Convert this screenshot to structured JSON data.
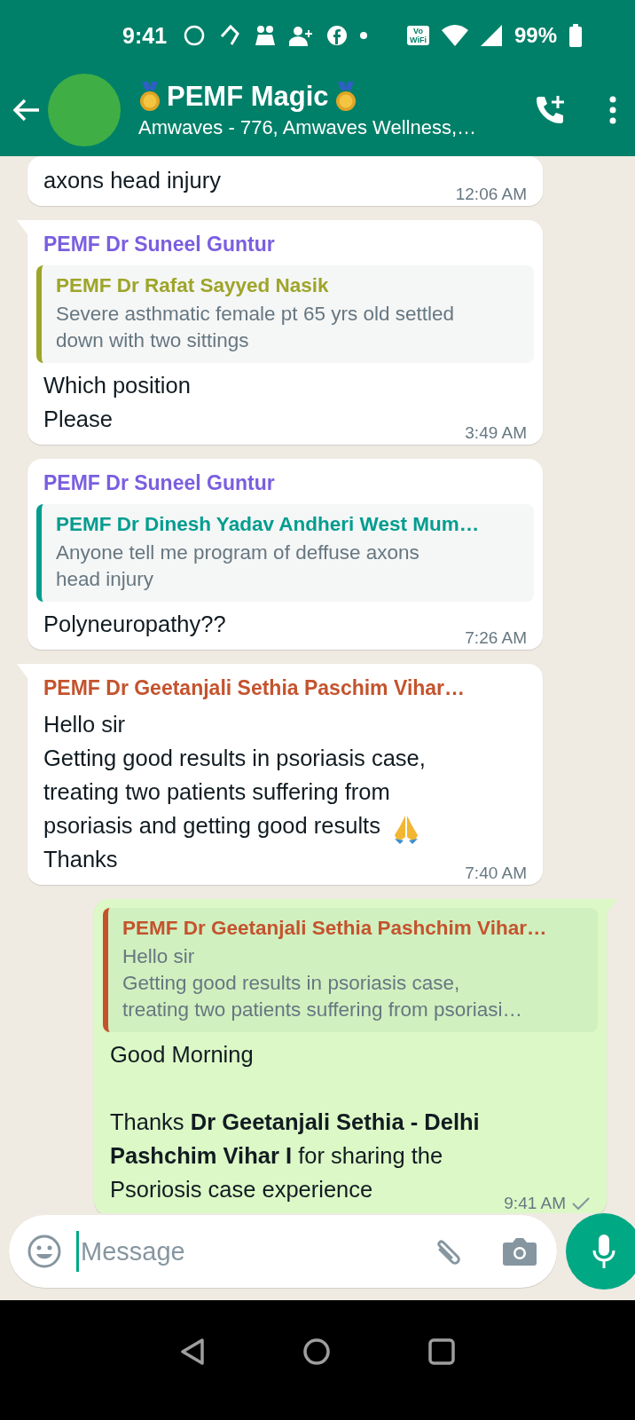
{
  "status_bar": {
    "time": "9:41",
    "vowifi": [
      "Vo",
      "WiFi"
    ],
    "battery": "99%"
  },
  "header": {
    "title": "PEMF Magic",
    "subtitle": "Amwaves - 776, Amwaves Wellness,…"
  },
  "messages": [
    {
      "kind": "incoming",
      "tail": false,
      "paragraphs": [
        {
          "text": "axons head injury",
          "emoji": false
        }
      ],
      "time": "12:06 AM"
    },
    {
      "kind": "incoming",
      "tail": true,
      "sender": {
        "name": "PEMF Dr Suneel Guntur",
        "color": "#7a5ee0"
      },
      "quote": {
        "author": "PEMF Dr Rafat Sayyed Nasik",
        "color": "#9ea529",
        "text": "Severe asthmatic female pt 65 yrs old settled\ndown with two sittings"
      },
      "paragraphs": [
        {
          "text": "Which position\nPlease",
          "emoji": false
        }
      ],
      "time": "3:49 AM"
    },
    {
      "kind": "incoming",
      "tail": false,
      "sender": {
        "name": "PEMF Dr Suneel Guntur",
        "color": "#7a5ee0"
      },
      "quote": {
        "author": "PEMF Dr Dinesh Yadav Andheri West Mum…",
        "color": "#029d8f",
        "text": "Anyone tell me program of deffuse axons\nhead injury"
      },
      "paragraphs": [
        {
          "text": "Polyneuropathy??",
          "emoji": false
        }
      ],
      "time": "7:26 AM"
    },
    {
      "kind": "incoming",
      "tail": true,
      "sender": {
        "name": "PEMF Dr Geetanjali Sethia Paschim Vihar…",
        "color": "#c4532d"
      },
      "paragraphs": [
        {
          "text": "Hello sir\nGetting good results in psoriasis case,\ntreating two patients suffering from\npsoriasis and getting good results",
          "emoji": true
        },
        {
          "text": "Thanks",
          "emoji": false
        }
      ],
      "time": "7:40 AM"
    },
    {
      "kind": "outgoing",
      "tail": true,
      "quote": {
        "author": "PEMF Dr Geetanjali Sethia Pashchim Vihar…",
        "color": "#c4532d",
        "text": "Hello sir\nGetting good results in psoriasis case,\ntreating two patients suffering from psoriasi…"
      },
      "paragraphs": [
        {
          "text": "Good Morning\n\nThanks **Dr Geetanjali Sethia - Delhi\nPashchim Vihar I** for sharing the\nPsoriosis case experience",
          "emoji": false
        }
      ],
      "time": "9:41 AM",
      "sent": true
    }
  ],
  "composer": {
    "placeholder": "Message"
  }
}
